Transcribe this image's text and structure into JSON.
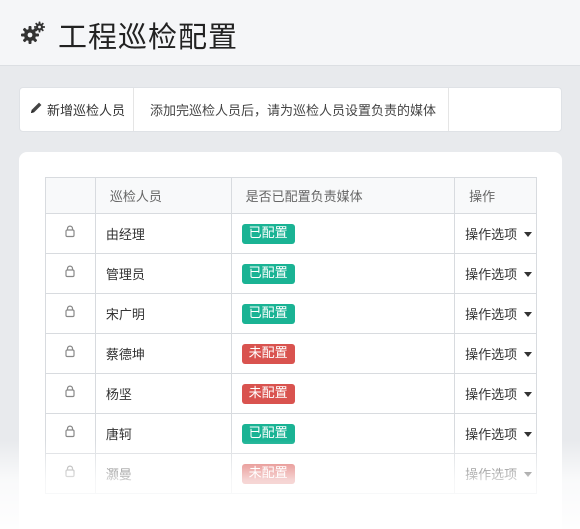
{
  "header": {
    "title": "工程巡检配置",
    "icon": "gears-icon"
  },
  "toolbar": {
    "add_label": "新增巡检人员",
    "add_icon": "pencil-icon",
    "hint": "添加完巡检人员后，请为巡检人员设置负责的媒体"
  },
  "table": {
    "headers": {
      "icon": "",
      "name": "巡检人员",
      "status": "是否已配置负责媒体",
      "op": "操作"
    },
    "rows": [
      {
        "name": "由经理",
        "status": "已配置",
        "configured": true,
        "op": "操作选项"
      },
      {
        "name": "管理员",
        "status": "已配置",
        "configured": true,
        "op": "操作选项"
      },
      {
        "name": "宋广明",
        "status": "已配置",
        "configured": true,
        "op": "操作选项"
      },
      {
        "name": "蔡德坤",
        "status": "未配置",
        "configured": false,
        "op": "操作选项"
      },
      {
        "name": "杨坚",
        "status": "未配置",
        "configured": false,
        "op": "操作选项"
      },
      {
        "name": "唐轲",
        "status": "已配置",
        "configured": true,
        "op": "操作选项"
      },
      {
        "name": "灏曼",
        "status": "未配置",
        "configured": false,
        "op": "操作选项"
      }
    ]
  },
  "colors": {
    "configured": "#1ab394",
    "not_configured": "#d9534f"
  }
}
